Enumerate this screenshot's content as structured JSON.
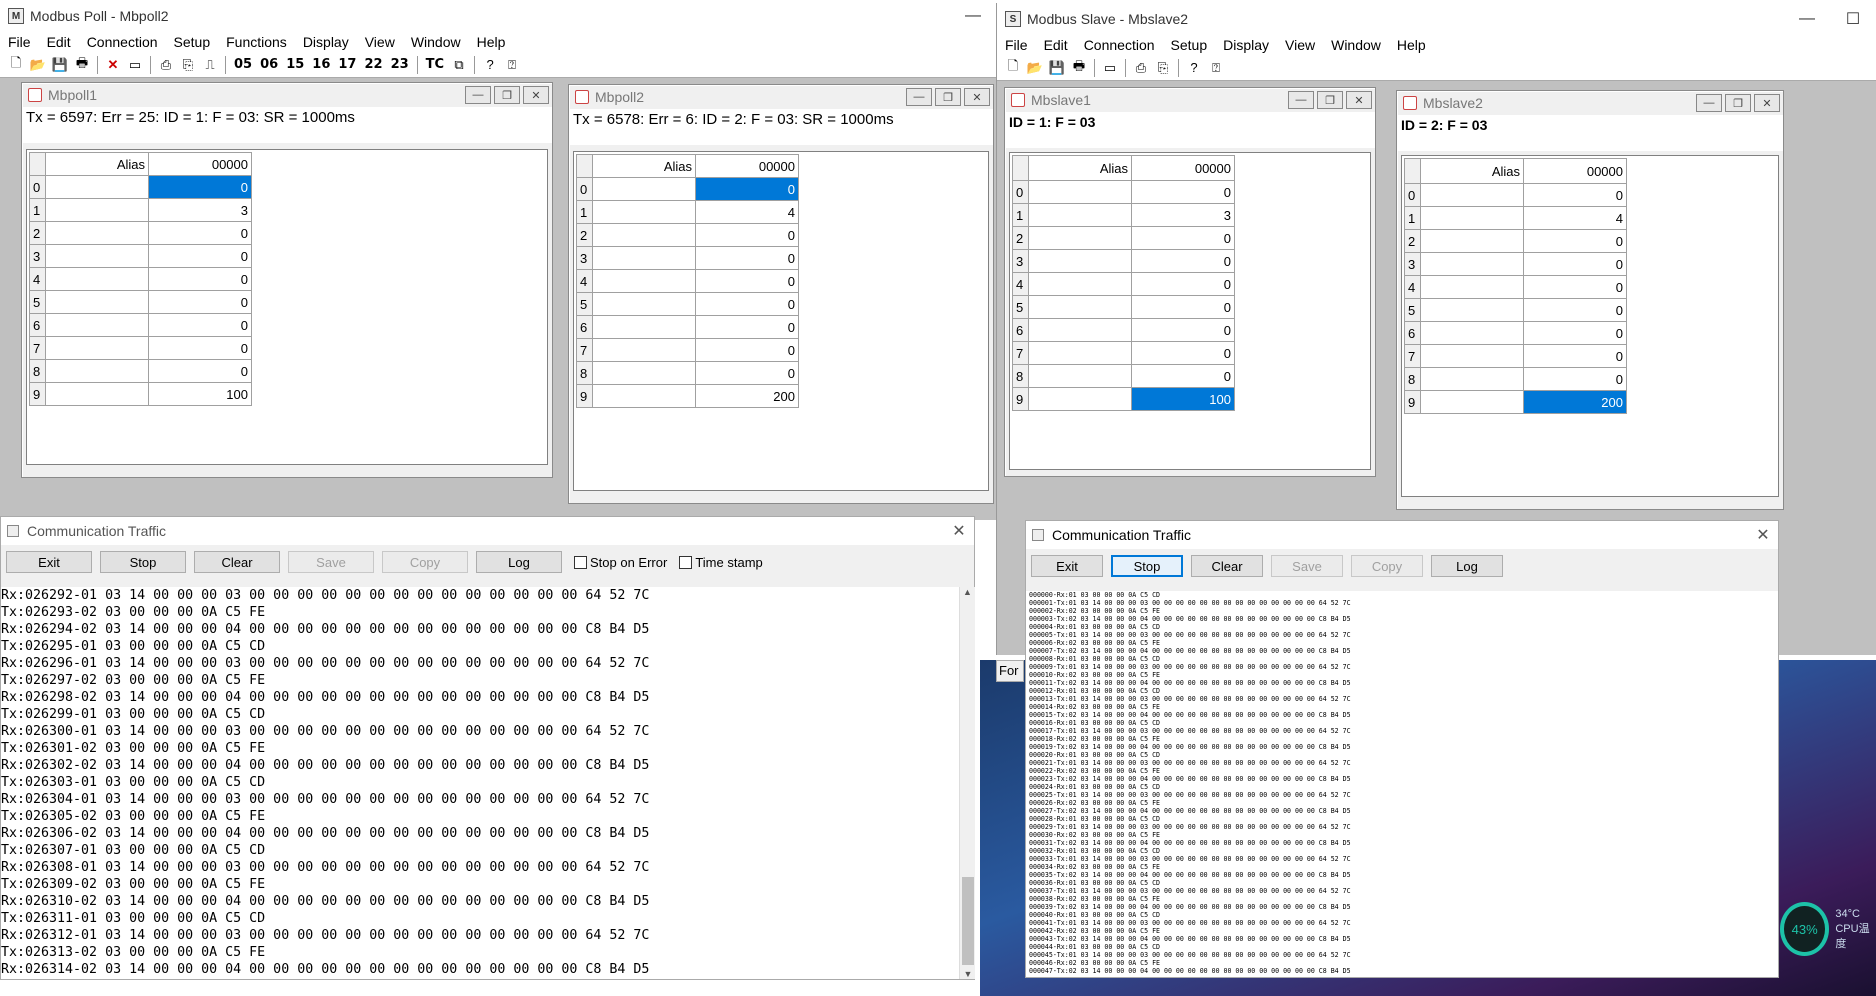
{
  "poll": {
    "title": "Modbus Poll - Mbpoll2",
    "menu": [
      "File",
      "Edit",
      "Connection",
      "Setup",
      "Functions",
      "Display",
      "View",
      "Window",
      "Help"
    ],
    "toolbar_codes": [
      "05",
      "06",
      "15",
      "16",
      "17",
      "22",
      "23"
    ],
    "toolbar_tc": "TC",
    "windows": [
      {
        "title": "Mbpoll1",
        "status": "Tx = 6597: Err = 25: ID = 1: F = 03: SR = 1000ms",
        "alias_header": "Alias",
        "col_header": "00000",
        "rows": [
          {
            "n": "0",
            "v": "0"
          },
          {
            "n": "1",
            "v": "3"
          },
          {
            "n": "2",
            "v": "0"
          },
          {
            "n": "3",
            "v": "0"
          },
          {
            "n": "4",
            "v": "0"
          },
          {
            "n": "5",
            "v": "0"
          },
          {
            "n": "6",
            "v": "0"
          },
          {
            "n": "7",
            "v": "0"
          },
          {
            "n": "8",
            "v": "0"
          },
          {
            "n": "9",
            "v": "100"
          }
        ]
      },
      {
        "title": "Mbpoll2",
        "status": "Tx = 6578: Err = 6: ID = 2: F = 03: SR = 1000ms",
        "alias_header": "Alias",
        "col_header": "00000",
        "rows": [
          {
            "n": "0",
            "v": "0"
          },
          {
            "n": "1",
            "v": "4"
          },
          {
            "n": "2",
            "v": "0"
          },
          {
            "n": "3",
            "v": "0"
          },
          {
            "n": "4",
            "v": "0"
          },
          {
            "n": "5",
            "v": "0"
          },
          {
            "n": "6",
            "v": "0"
          },
          {
            "n": "7",
            "v": "0"
          },
          {
            "n": "8",
            "v": "0"
          },
          {
            "n": "9",
            "v": "200"
          }
        ]
      }
    ],
    "traffic": {
      "title": "Communication Traffic",
      "buttons": [
        "Exit",
        "Stop",
        "Clear",
        "Save",
        "Copy",
        "Log"
      ],
      "checkboxes": [
        "Stop on Error",
        "Time stamp"
      ],
      "lines": [
        "Rx:026292-01 03 14 00 00 00 03 00 00 00 00 00 00 00 00 00 00 00 00 00 00 64 52 7C",
        "Tx:026293-02 03 00 00 00 0A C5 FE",
        "Rx:026294-02 03 14 00 00 00 04 00 00 00 00 00 00 00 00 00 00 00 00 00 00 C8 B4 D5",
        "Tx:026295-01 03 00 00 00 0A C5 CD",
        "Rx:026296-01 03 14 00 00 00 03 00 00 00 00 00 00 00 00 00 00 00 00 00 00 64 52 7C",
        "Tx:026297-02 03 00 00 00 0A C5 FE",
        "Rx:026298-02 03 14 00 00 00 04 00 00 00 00 00 00 00 00 00 00 00 00 00 00 C8 B4 D5",
        "Tx:026299-01 03 00 00 00 0A C5 CD",
        "Rx:026300-01 03 14 00 00 00 03 00 00 00 00 00 00 00 00 00 00 00 00 00 00 64 52 7C",
        "Tx:026301-02 03 00 00 00 0A C5 FE",
        "Rx:026302-02 03 14 00 00 00 04 00 00 00 00 00 00 00 00 00 00 00 00 00 00 C8 B4 D5",
        "Tx:026303-01 03 00 00 00 0A C5 CD",
        "Rx:026304-01 03 14 00 00 00 03 00 00 00 00 00 00 00 00 00 00 00 00 00 00 64 52 7C",
        "Tx:026305-02 03 00 00 00 0A C5 FE",
        "Rx:026306-02 03 14 00 00 00 04 00 00 00 00 00 00 00 00 00 00 00 00 00 00 C8 B4 D5",
        "Tx:026307-01 03 00 00 00 0A C5 CD",
        "Rx:026308-01 03 14 00 00 00 03 00 00 00 00 00 00 00 00 00 00 00 00 00 00 64 52 7C",
        "Tx:026309-02 03 00 00 00 0A C5 FE",
        "Rx:026310-02 03 14 00 00 00 04 00 00 00 00 00 00 00 00 00 00 00 00 00 00 C8 B4 D5",
        "Tx:026311-01 03 00 00 00 0A C5 CD",
        "Rx:026312-01 03 14 00 00 00 03 00 00 00 00 00 00 00 00 00 00 00 00 00 00 64 52 7C",
        "Tx:026313-02 03 00 00 00 0A C5 FE",
        "Rx:026314-02 03 14 00 00 00 04 00 00 00 00 00 00 00 00 00 00 00 00 00 00 C8 B4 D5"
      ]
    }
  },
  "slave": {
    "title": "Modbus Slave - Mbslave2",
    "menu": [
      "File",
      "Edit",
      "Connection",
      "Setup",
      "Display",
      "View",
      "Window",
      "Help"
    ],
    "windows": [
      {
        "title": "Mbslave1",
        "status": "ID = 1: F = 03",
        "alias_header": "Alias",
        "col_header": "00000",
        "rows": [
          {
            "n": "0",
            "v": "0"
          },
          {
            "n": "1",
            "v": "3"
          },
          {
            "n": "2",
            "v": "0"
          },
          {
            "n": "3",
            "v": "0"
          },
          {
            "n": "4",
            "v": "0"
          },
          {
            "n": "5",
            "v": "0"
          },
          {
            "n": "6",
            "v": "0"
          },
          {
            "n": "7",
            "v": "0"
          },
          {
            "n": "8",
            "v": "0"
          },
          {
            "n": "9",
            "v": "100"
          }
        ]
      },
      {
        "title": "Mbslave2",
        "status": "ID = 2: F = 03",
        "alias_header": "Alias",
        "col_header": "00000",
        "rows": [
          {
            "n": "0",
            "v": "0"
          },
          {
            "n": "1",
            "v": "4"
          },
          {
            "n": "2",
            "v": "0"
          },
          {
            "n": "3",
            "v": "0"
          },
          {
            "n": "4",
            "v": "0"
          },
          {
            "n": "5",
            "v": "0"
          },
          {
            "n": "6",
            "v": "0"
          },
          {
            "n": "7",
            "v": "0"
          },
          {
            "n": "8",
            "v": "0"
          },
          {
            "n": "9",
            "v": "200"
          }
        ]
      }
    ],
    "traffic": {
      "title": "Communication Traffic",
      "buttons": [
        "Exit",
        "Stop",
        "Clear",
        "Save",
        "Copy",
        "Log"
      ],
      "lines": [
        "000000-Rx:01 03 00 00 00 0A C5 CD",
        "000001-Tx:01 03 14 00 00 00 03 00 00 00 00 00 00 00 00 00 00 00 00 00 00 64 52 7C",
        "000002-Rx:02 03 00 00 00 0A C5 FE",
        "000003-Tx:02 03 14 00 00 00 04 00 00 00 00 00 00 00 00 00 00 00 00 00 00 C8 B4 D5",
        "000004-Rx:01 03 00 00 00 0A C5 CD",
        "000005-Tx:01 03 14 00 00 00 03 00 00 00 00 00 00 00 00 00 00 00 00 00 00 64 52 7C",
        "000006-Rx:02 03 00 00 00 0A C5 FE",
        "000007-Tx:02 03 14 00 00 00 04 00 00 00 00 00 00 00 00 00 00 00 00 00 00 C8 B4 D5",
        "000008-Rx:01 03 00 00 00 0A C5 CD",
        "000009-Tx:01 03 14 00 00 00 03 00 00 00 00 00 00 00 00 00 00 00 00 00 00 64 52 7C",
        "000010-Rx:02 03 00 00 00 0A C5 FE",
        "000011-Tx:02 03 14 00 00 00 04 00 00 00 00 00 00 00 00 00 00 00 00 00 00 C8 B4 D5",
        "000012-Rx:01 03 00 00 00 0A C5 CD",
        "000013-Tx:01 03 14 00 00 00 03 00 00 00 00 00 00 00 00 00 00 00 00 00 00 64 52 7C",
        "000014-Rx:02 03 00 00 00 0A C5 FE",
        "000015-Tx:02 03 14 00 00 00 04 00 00 00 00 00 00 00 00 00 00 00 00 00 00 C8 B4 D5",
        "000016-Rx:01 03 00 00 00 0A C5 CD",
        "000017-Tx:01 03 14 00 00 00 03 00 00 00 00 00 00 00 00 00 00 00 00 00 00 64 52 7C",
        "000018-Rx:02 03 00 00 00 0A C5 FE",
        "000019-Tx:02 03 14 00 00 00 04 00 00 00 00 00 00 00 00 00 00 00 00 00 00 C8 B4 D5",
        "000020-Rx:01 03 00 00 00 0A C5 CD",
        "000021-Tx:01 03 14 00 00 00 03 00 00 00 00 00 00 00 00 00 00 00 00 00 00 64 52 7C",
        "000022-Rx:02 03 00 00 00 0A C5 FE",
        "000023-Tx:02 03 14 00 00 00 04 00 00 00 00 00 00 00 00 00 00 00 00 00 00 C8 B4 D5",
        "000024-Rx:01 03 00 00 00 0A C5 CD",
        "000025-Tx:01 03 14 00 00 00 03 00 00 00 00 00 00 00 00 00 00 00 00 00 00 64 52 7C",
        "000026-Rx:02 03 00 00 00 0A C5 FE",
        "000027-Tx:02 03 14 00 00 00 04 00 00 00 00 00 00 00 00 00 00 00 00 00 00 C8 B4 D5",
        "000028-Rx:01 03 00 00 00 0A C5 CD",
        "000029-Tx:01 03 14 00 00 00 03 00 00 00 00 00 00 00 00 00 00 00 00 00 00 64 52 7C",
        "000030-Rx:02 03 00 00 00 0A C5 FE",
        "000031-Tx:02 03 14 00 00 00 04 00 00 00 00 00 00 00 00 00 00 00 00 00 00 C8 B4 D5",
        "000032-Rx:01 03 00 00 00 0A C5 CD",
        "000033-Tx:01 03 14 00 00 00 03 00 00 00 00 00 00 00 00 00 00 00 00 00 00 64 52 7C",
        "000034-Rx:02 03 00 00 00 0A C5 FE",
        "000035-Tx:02 03 14 00 00 00 04 00 00 00 00 00 00 00 00 00 00 00 00 00 00 C8 B4 D5",
        "000036-Rx:01 03 00 00 00 0A C5 CD",
        "000037-Tx:01 03 14 00 00 00 03 00 00 00 00 00 00 00 00 00 00 00 00 00 00 64 52 7C",
        "000038-Rx:02 03 00 00 00 0A C5 FE",
        "000039-Tx:02 03 14 00 00 00 04 00 00 00 00 00 00 00 00 00 00 00 00 00 00 C8 B4 D5",
        "000040-Rx:01 03 00 00 00 0A C5 CD",
        "000041-Tx:01 03 14 00 00 00 03 00 00 00 00 00 00 00 00 00 00 00 00 00 00 64 52 7C",
        "000042-Rx:02 03 00 00 00 0A C5 FE",
        "000043-Tx:02 03 14 00 00 00 04 00 00 00 00 00 00 00 00 00 00 00 00 00 00 C8 B4 D5",
        "000044-Rx:01 03 00 00 00 0A C5 CD",
        "000045-Tx:01 03 14 00 00 00 03 00 00 00 00 00 00 00 00 00 00 00 00 00 00 64 52 7C",
        "000046-Rx:02 03 00 00 00 0A C5 FE",
        "000047-Tx:02 03 14 00 00 00 04 00 00 00 00 00 00 00 00 00 00 00 00 00 00 C8 B4 D5"
      ]
    }
  },
  "bg_label": "For",
  "cpu_widget": {
    "percent": "43%",
    "temp": "34°C",
    "label": "CPU温度"
  },
  "colors": {
    "selection": "#0078d7",
    "mdi_bg": "#c0c0c0",
    "focus_border": "#0078d7"
  }
}
